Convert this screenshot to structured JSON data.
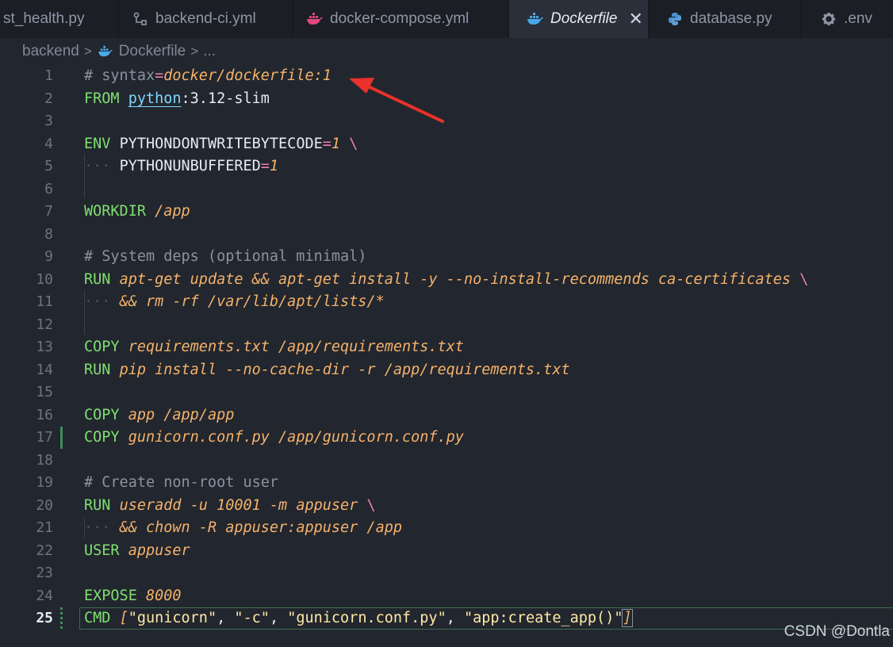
{
  "tabs": [
    {
      "label": "st_health.py",
      "icon": "python-icon",
      "active": false
    },
    {
      "label": "backend-ci.yml",
      "icon": "git-branch-icon",
      "active": false
    },
    {
      "label": "docker-compose.yml",
      "icon": "docker-icon",
      "active": false
    },
    {
      "label": "Dockerfile",
      "icon": "docker-icon",
      "active": true,
      "close": "✕"
    },
    {
      "label": "database.py",
      "icon": "python-icon",
      "active": false
    },
    {
      "label": ".env",
      "icon": "gear-icon",
      "active": false
    }
  ],
  "breadcrumb": {
    "folder": "backend",
    "file": "Dockerfile",
    "more": "...",
    "separator": ">"
  },
  "editor": {
    "current_line": 25,
    "lines": [
      {
        "n": "1"
      },
      {
        "n": "2"
      },
      {
        "n": "3"
      },
      {
        "n": "4"
      },
      {
        "n": "5"
      },
      {
        "n": "6"
      },
      {
        "n": "7"
      },
      {
        "n": "8"
      },
      {
        "n": "9"
      },
      {
        "n": "10"
      },
      {
        "n": "11"
      },
      {
        "n": "12"
      },
      {
        "n": "13"
      },
      {
        "n": "14"
      },
      {
        "n": "15"
      },
      {
        "n": "16"
      },
      {
        "n": "17"
      },
      {
        "n": "18"
      },
      {
        "n": "19"
      },
      {
        "n": "20"
      },
      {
        "n": "21"
      },
      {
        "n": "22"
      },
      {
        "n": "23"
      },
      {
        "n": "24"
      },
      {
        "n": "25"
      }
    ],
    "code": {
      "l1": {
        "hash": "#",
        "key": "syntax",
        "eq": "=",
        "val": "docker/dockerfile:1"
      },
      "l2": {
        "kw": "FROM",
        "image": "python",
        "tag": ":3.12-slim"
      },
      "l4": {
        "kw": "ENV",
        "name": "PYTHONDONTWRITEBYTECODE",
        "eq": "=",
        "val": "1",
        "bs": "\\"
      },
      "l5": {
        "name": "PYTHONUNBUFFERED",
        "eq": "=",
        "val": "1"
      },
      "l7": {
        "kw": "WORKDIR",
        "arg": "/app"
      },
      "l9": {
        "comment": "# System deps (optional minimal)"
      },
      "l10": {
        "kw": "RUN",
        "arg": "apt-get update && apt-get install -y --no-install-recommends ca-certificates",
        "bs": "\\"
      },
      "l11": {
        "arg": "&& rm -rf /var/lib/apt/lists/*"
      },
      "l13": {
        "kw": "COPY",
        "arg": "requirements.txt /app/requirements.txt"
      },
      "l14": {
        "kw": "RUN",
        "arg": "pip install --no-cache-dir -r /app/requirements.txt"
      },
      "l16": {
        "kw": "COPY",
        "arg": "app /app/app"
      },
      "l17": {
        "kw": "COPY",
        "arg": "gunicorn.conf.py /app/gunicorn.conf.py"
      },
      "l19": {
        "comment": "# Create non-root user"
      },
      "l20": {
        "kw": "RUN",
        "arg": "useradd -u 10001 -m appuser",
        "bs": "\\"
      },
      "l21": {
        "arg": "&& chown -R appuser:appuser /app"
      },
      "l22": {
        "kw": "USER",
        "arg": "appuser"
      },
      "l24": {
        "kw": "EXPOSE",
        "arg": "8000"
      },
      "l25": {
        "kw": "CMD",
        "open": "[",
        "s1": "\"gunicorn\"",
        "s2": "\"-c\"",
        "s3": "\"gunicorn.conf.py\"",
        "s4": "\"app:create_app()\"",
        "comma": ", ",
        "close": "]"
      }
    }
  },
  "watermark": "CSDN @Dontla",
  "colors": {
    "keyword": "#7fe070",
    "argument": "#f5b26b",
    "operator": "#f07fb0",
    "string": "#ffe9a6",
    "comment": "#8a93a3",
    "annotation_arrow": "#e8322b"
  }
}
